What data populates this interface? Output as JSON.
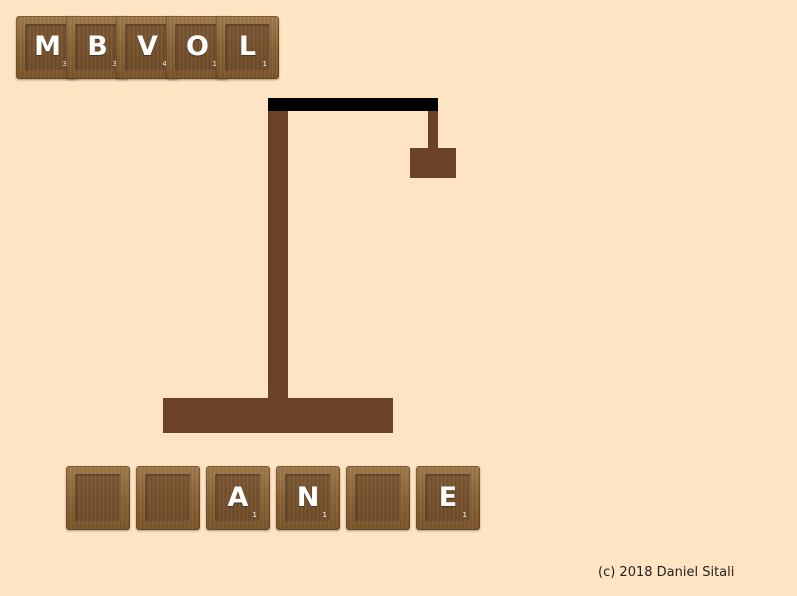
{
  "used_letters": [
    {
      "letter": "M",
      "score": "3"
    },
    {
      "letter": "B",
      "score": "3"
    },
    {
      "letter": "V",
      "score": "4"
    },
    {
      "letter": "O",
      "score": "1"
    },
    {
      "letter": "L",
      "score": "1"
    }
  ],
  "word_slots": [
    {
      "letter": "",
      "score": ""
    },
    {
      "letter": "",
      "score": ""
    },
    {
      "letter": "A",
      "score": "1"
    },
    {
      "letter": "N",
      "score": "1"
    },
    {
      "letter": "",
      "score": ""
    },
    {
      "letter": "E",
      "score": "1"
    }
  ],
  "colors": {
    "background": "#ffe4c4",
    "gallows": "#6b4226",
    "beam": "#000000",
    "tile_text": "#ffffff"
  },
  "footer": {
    "copyright": "(c) 2018 Daniel Sitali"
  }
}
